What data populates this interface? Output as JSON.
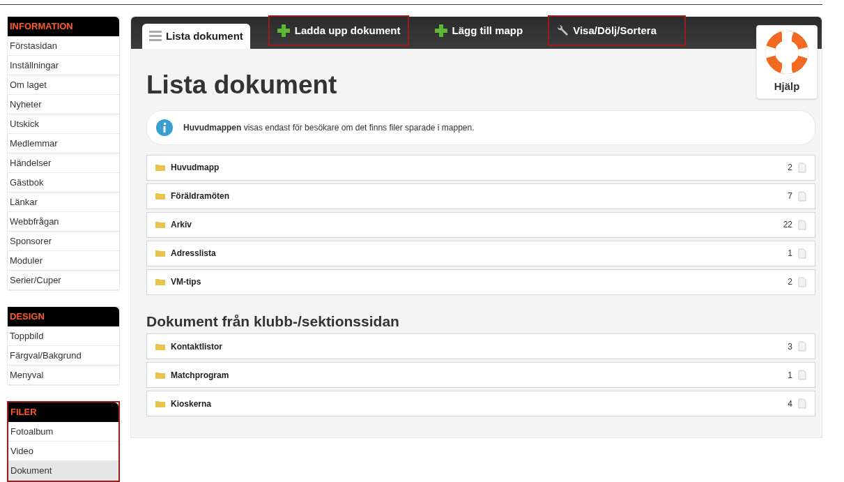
{
  "sidebar": {
    "sections": [
      {
        "title": "INFORMATION",
        "highlighted": false,
        "items": [
          {
            "label": "Förstasidan",
            "selected": false
          },
          {
            "label": "Inställningar",
            "selected": false
          },
          {
            "label": "Om laget",
            "selected": false
          },
          {
            "label": "Nyheter",
            "selected": false
          },
          {
            "label": "Utskick",
            "selected": false
          },
          {
            "label": "Medlemmar",
            "selected": false
          },
          {
            "label": "Händelser",
            "selected": false
          },
          {
            "label": "Gästbok",
            "selected": false
          },
          {
            "label": "Länkar",
            "selected": false
          },
          {
            "label": "Webbfrågan",
            "selected": false
          },
          {
            "label": "Sponsorer",
            "selected": false
          },
          {
            "label": "Moduler",
            "selected": false
          },
          {
            "label": "Serier/Cuper",
            "selected": false
          }
        ]
      },
      {
        "title": "DESIGN",
        "highlighted": false,
        "items": [
          {
            "label": "Toppbild",
            "selected": false
          },
          {
            "label": "Färgval/Bakgrund",
            "selected": false
          },
          {
            "label": "Menyval",
            "selected": false
          }
        ]
      },
      {
        "title": "FILER",
        "highlighted": true,
        "items": [
          {
            "label": "Fotoalbum",
            "selected": false
          },
          {
            "label": "Video",
            "selected": false
          },
          {
            "label": "Dokument",
            "selected": true
          }
        ]
      }
    ]
  },
  "tabs": [
    {
      "label": "Lista dokument",
      "kind": "list",
      "selected": true,
      "highlighted": false
    },
    {
      "label": "Ladda upp dokument",
      "kind": "add",
      "selected": false,
      "highlighted": true
    },
    {
      "label": "Lägg till mapp",
      "kind": "add",
      "selected": false,
      "highlighted": false
    },
    {
      "label": "Visa/Dölj/Sortera",
      "kind": "tool",
      "selected": false,
      "highlighted": true
    }
  ],
  "help": {
    "label": "Hjälp"
  },
  "title": "Lista dokument",
  "info": "**Huvudmappen** visas endast för besökare om det finns filer sparade i mappen.",
  "folders": [
    {
      "name": "Huvudmapp",
      "count": "2"
    },
    {
      "name": "Föräldramöten",
      "count": "7"
    },
    {
      "name": "Arkiv",
      "count": "22"
    },
    {
      "name": "Adresslista",
      "count": "1"
    },
    {
      "name": "VM-tips",
      "count": "2"
    }
  ],
  "club_section": {
    "title": "Dokument från klubb-/sektionssidan",
    "folders": [
      {
        "name": "Kontaktlistor",
        "count": "3"
      },
      {
        "name": "Matchprogram",
        "count": "1"
      },
      {
        "name": "Kioskerna",
        "count": "4"
      }
    ]
  }
}
